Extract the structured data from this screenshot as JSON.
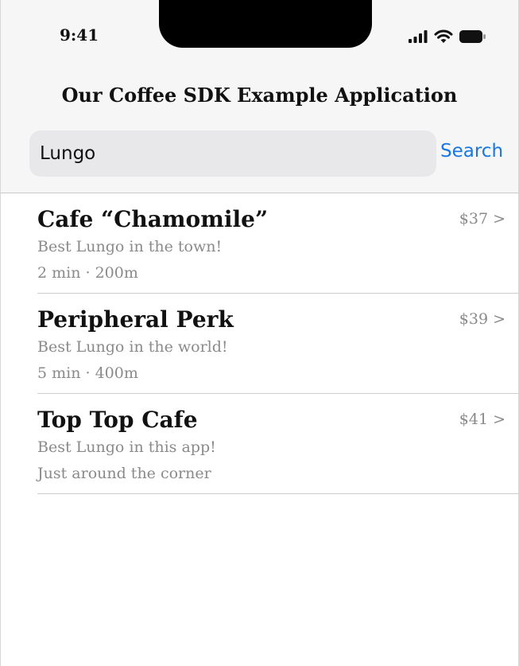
{
  "status_bar": {
    "time": "9:41",
    "icons": [
      "cellular-signal-icon",
      "wifi-icon",
      "battery-icon"
    ]
  },
  "header": {
    "title": "Our Coffee SDK Example Application"
  },
  "search": {
    "value": "Lungo",
    "button_label": "Search"
  },
  "results": [
    {
      "name": "Cafe “Chamomile”",
      "description": "Best Lungo in the town!",
      "meta": "2 min · 200m",
      "price": "$37 >"
    },
    {
      "name": "Peripheral Perk",
      "description": "Best Lungo in the world!",
      "meta": "5 min · 400m",
      "price": "$39 >"
    },
    {
      "name": "Top Top Cafe",
      "description": "Best Lungo in this app!",
      "meta": "Just around the corner",
      "price": "$41 >"
    }
  ],
  "colors": {
    "accent": "#1877e5",
    "secondary_text": "#8a8a8a",
    "header_background": "#f6f6f6",
    "search_field_background": "#e8e8ea"
  }
}
